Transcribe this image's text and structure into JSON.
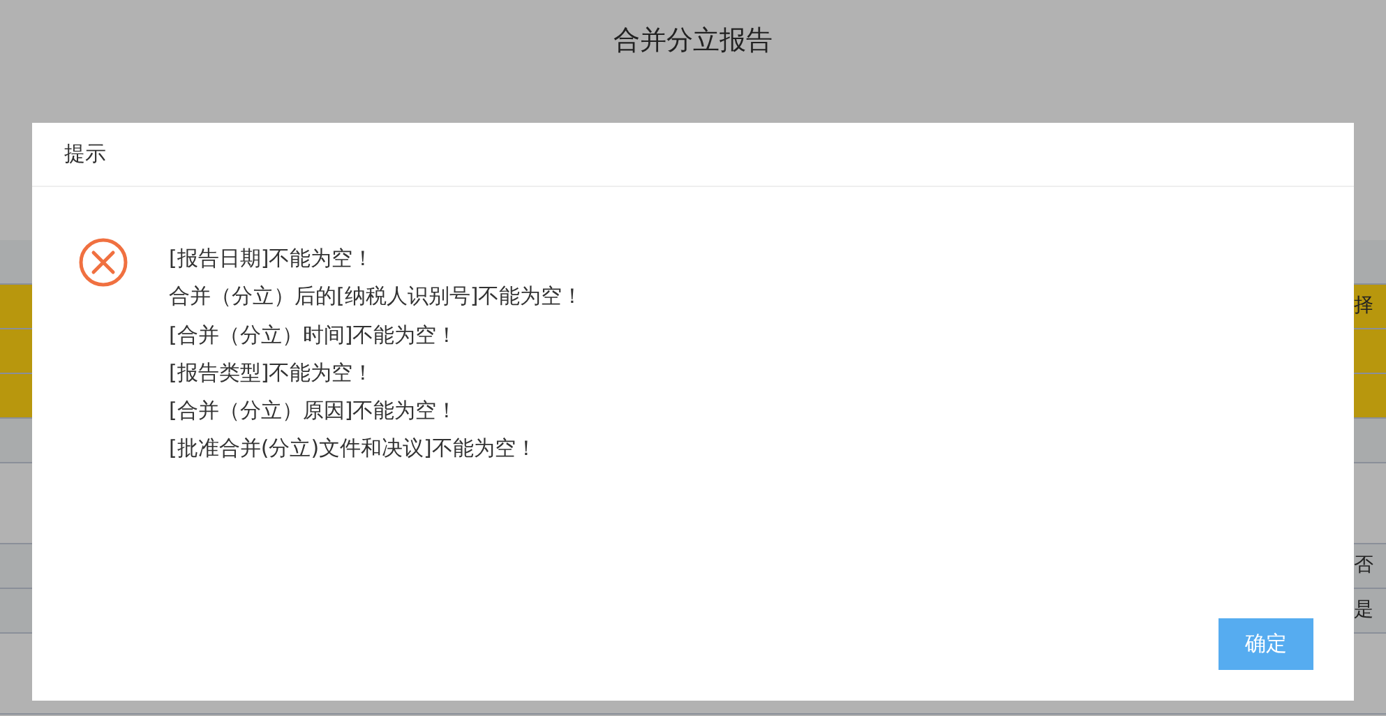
{
  "page": {
    "title": "合并分立报告"
  },
  "background_cells": [
    {
      "kind": "plain"
    },
    {
      "kind": "gold",
      "text": "择"
    },
    {
      "kind": "gold"
    },
    {
      "kind": "gold"
    },
    {
      "kind": "plain"
    },
    {
      "kind": "tall"
    },
    {
      "kind": "plain",
      "text": "否"
    },
    {
      "kind": "plain",
      "text": "是"
    },
    {
      "kind": "tall"
    }
  ],
  "dialog": {
    "title": "提示",
    "kind": "error",
    "messages": [
      "[报告日期]不能为空！",
      "合并（分立）后的[纳税人识别号]不能为空！",
      "[合并（分立）时间]不能为空！",
      "[报告类型]不能为空！",
      "[合并（分立）原因]不能为空！",
      "[批准合并(分立)文件和决议]不能为空！"
    ],
    "confirm_button": "确定"
  }
}
